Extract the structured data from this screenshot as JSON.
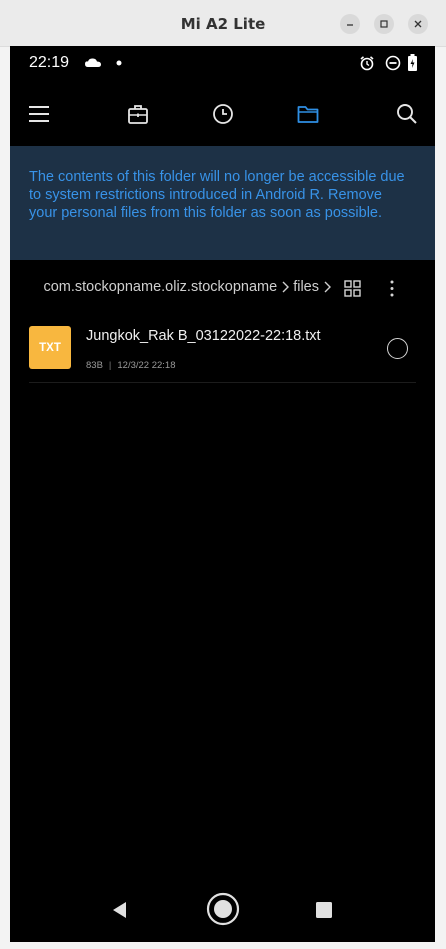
{
  "window": {
    "title": "Mi A2 Lite",
    "controls": [
      "minimize-icon",
      "maximize-icon",
      "close-icon"
    ]
  },
  "statusbar": {
    "time": "22:19",
    "left_icons": [
      "cloud-icon",
      "dot-icon"
    ],
    "right_icons": [
      "alarm-icon",
      "do-not-disturb-icon",
      "battery-icon"
    ]
  },
  "toolbar": {
    "icons": [
      "menu-icon",
      "briefcase-icon",
      "history-clock-icon",
      "folder-icon",
      "search-icon"
    ],
    "active": "folder-icon",
    "accent_color": "#2f8fe4"
  },
  "banner": {
    "text": "The contents of this folder will no longer be accessible due to system restrictions introduced in Android R. Remove your personal files from this folder as soon as possible.",
    "background": "#1d3146",
    "text_color": "#3893e8"
  },
  "path": {
    "crumbs": [
      "com.stockopname.oliz.stockopname",
      "files"
    ],
    "actions": [
      "grid-view-icon",
      "more-vert-icon"
    ]
  },
  "files": [
    {
      "type_badge": "TXT",
      "badge_color": "#f8b73f",
      "name": "Jungkok_Rak B_03122022-22:18.txt",
      "size": "83B",
      "date": "12/3/22 22:18",
      "selected": false
    }
  ],
  "navbar": {
    "icons": [
      "back-icon",
      "home-icon",
      "recents-icon"
    ]
  }
}
